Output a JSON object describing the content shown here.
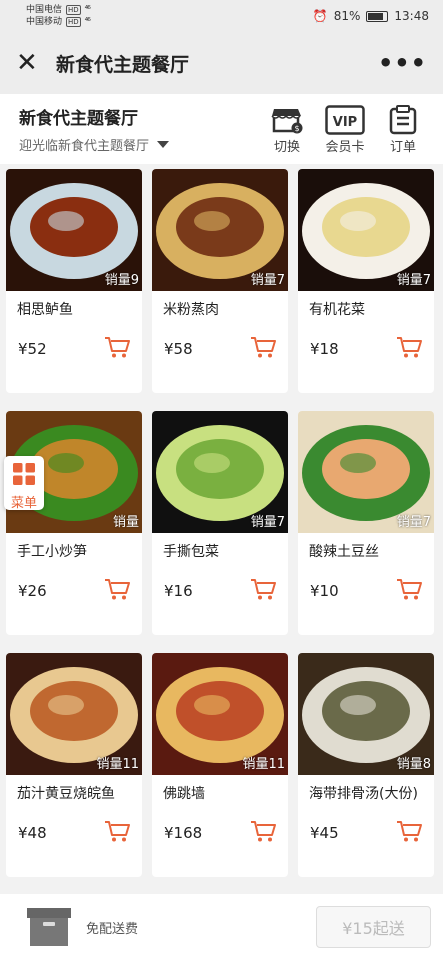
{
  "status": {
    "carrier1": "中国电信",
    "carrier2": "中国移动",
    "hd": "HD",
    "signal": "⁴⁶",
    "battery": "81%",
    "battery_level": 0.81,
    "time": "13:48"
  },
  "nav": {
    "title": "新食代主题餐厅"
  },
  "shop": {
    "name": "新食代主题餐厅",
    "welcome": "迎光临新食代主题餐厅",
    "switch_label": "切换",
    "vip_badge": "VIP",
    "vip_label": "会员卡",
    "orders_label": "订单"
  },
  "dishes": [
    {
      "name": "相思鲈鱼",
      "price": "¥52",
      "sales": "销量9",
      "colors": [
        "#2a1208",
        "#8a2e10",
        "#c8d8e0"
      ]
    },
    {
      "name": "米粉蒸肉",
      "price": "¥58",
      "sales": "销量7",
      "colors": [
        "#3a1a0c",
        "#7a3a1a",
        "#d8b060"
      ]
    },
    {
      "name": "有机花菜",
      "price": "¥18",
      "sales": "销量7",
      "colors": [
        "#1a0e0a",
        "#e8d890",
        "#f4f0e8"
      ]
    },
    {
      "name": "手工小炒笋",
      "price": "¥26",
      "sales": "销量",
      "colors": [
        "#6a3a12",
        "#c0862a",
        "#3a8a20"
      ]
    },
    {
      "name": "手撕包菜",
      "price": "¥16",
      "sales": "销量7",
      "colors": [
        "#101010",
        "#7ab040",
        "#c8e080"
      ]
    },
    {
      "name": "酸辣土豆丝",
      "price": "¥10",
      "sales": "销量7",
      "colors": [
        "#e8dcc0",
        "#e8a870",
        "#3a8a30"
      ]
    },
    {
      "name": "茄汁黄豆烧皖鱼",
      "price": "¥48",
      "sales": "销量11",
      "colors": [
        "#3a1a10",
        "#c06830",
        "#e8c890"
      ]
    },
    {
      "name": "佛跳墙",
      "price": "¥168",
      "sales": "销量11",
      "colors": [
        "#5a1a10",
        "#c0502a",
        "#e8b860"
      ]
    },
    {
      "name": "海带排骨汤(大份)",
      "price": "¥45",
      "sales": "销量8",
      "colors": [
        "#3a2a1a",
        "#6a6a4a",
        "#e0dcd0"
      ]
    }
  ],
  "float_menu": {
    "label": "菜单"
  },
  "bottom": {
    "delivery_text": "免配送费",
    "min_order": "¥15起送"
  },
  "colors": {
    "accent": "#e8643a"
  }
}
